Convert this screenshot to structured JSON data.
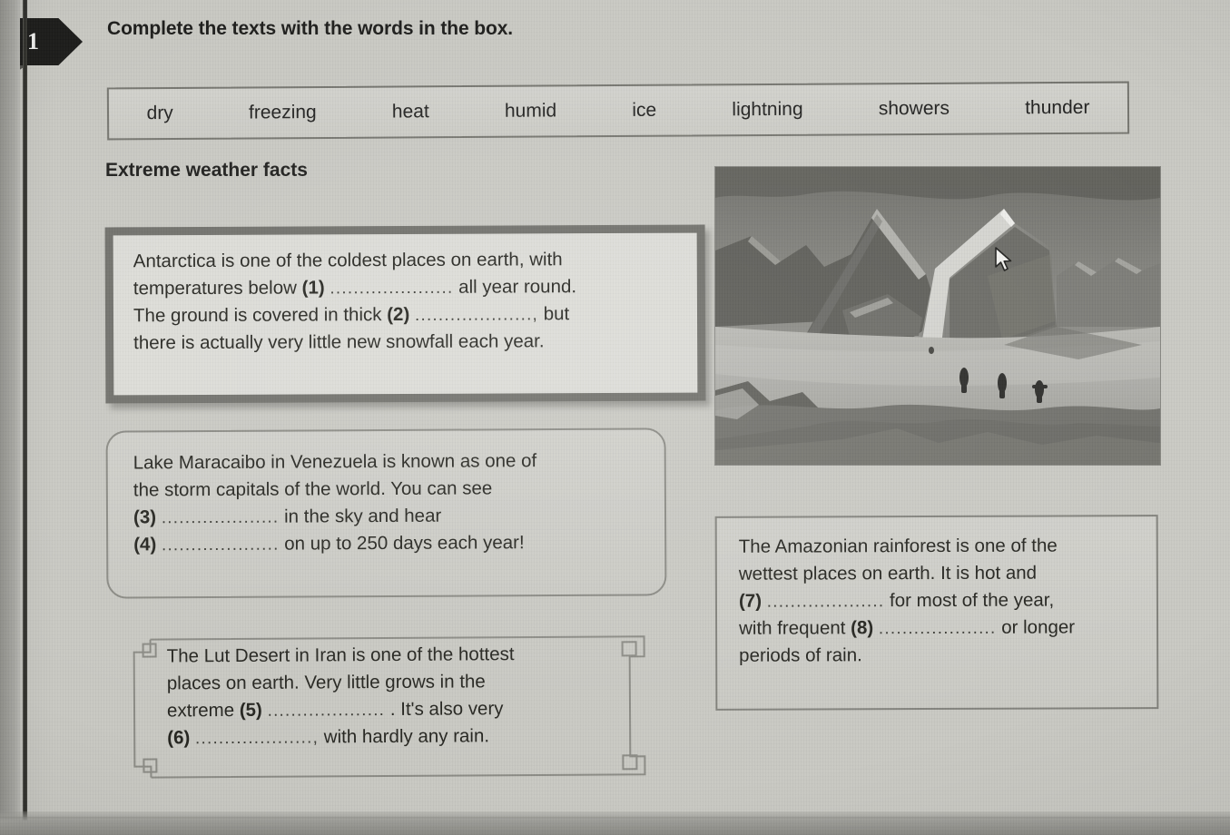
{
  "exercise": {
    "number": "1",
    "instruction": "Complete the texts with the words in the box."
  },
  "word_bank": {
    "words": [
      "dry",
      "freezing",
      "heat",
      "humid",
      "ice",
      "lightning",
      "showers",
      "thunder"
    ]
  },
  "section": {
    "title": "Extreme weather facts"
  },
  "facts": {
    "antarctica": {
      "line1": "Antarctica is one of the coldest places on earth, with",
      "line2_a": "temperatures below",
      "line2_gap": "(1)",
      "line2_dots": ".....................",
      "line2_b": "all year round.",
      "line3_a": "The ground is covered in thick",
      "line3_gap": "(2)",
      "line3_dots": "....................,",
      "line3_b": "but",
      "line4": "there is actually very little new snowfall each year."
    },
    "maracaibo": {
      "line1": "Lake Maracaibo in Venezuela is known as one of",
      "line2": "the storm capitals of the world. You can see",
      "line3_gap": "(3)",
      "line3_dots": "....................",
      "line3_b": "in the sky and hear",
      "line4_gap": "(4)",
      "line4_dots": "....................",
      "line4_b": "on up to 250 days each year!"
    },
    "lut": {
      "line1": "The Lut Desert in Iran is one of the hottest",
      "line2": "places on earth. Very little grows in the",
      "line3_a": "extreme",
      "line3_gap": "(5)",
      "line3_dots": "....................",
      "line3_b": ". It's also very",
      "line4_gap": "(6)",
      "line4_dots": "....................,",
      "line4_b": "with hardly any rain."
    },
    "amazon": {
      "line1": "The Amazonian rainforest is one of the",
      "line2": "wettest places on earth. It is hot and",
      "line3_gap": "(7)",
      "line3_dots": "....................",
      "line3_b": "for most of the year,",
      "line4_a": "with frequent",
      "line4_gap": "(8)",
      "line4_dots": "....................",
      "line4_b": "or longer",
      "line5": "periods of rain."
    }
  },
  "photo": {
    "description": "black-and-white antarctic landscape with icebergs and three penguins"
  },
  "colors": {
    "paper": "#c9c9c3",
    "ink": "#24241f",
    "badge": "#1c1c1a",
    "frame_thick": "#6f6f6a",
    "frame_thin": "#82827c"
  }
}
